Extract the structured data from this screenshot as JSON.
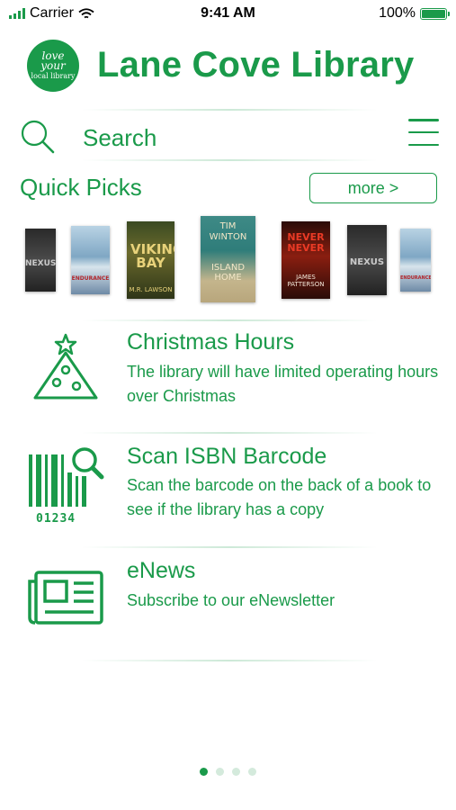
{
  "status_bar": {
    "carrier": "Carrier",
    "time": "9:41 AM",
    "battery": "100%"
  },
  "header": {
    "logo_lines": [
      "love",
      "your",
      "local",
      "library"
    ],
    "title": "Lane Cove Library"
  },
  "search": {
    "placeholder": "Search"
  },
  "quick_picks": {
    "title": "Quick Picks",
    "more_label": "more >",
    "books": [
      {
        "title": "NEXUS",
        "author": ""
      },
      {
        "title": "ENDURANCE",
        "author": ""
      },
      {
        "title": "VIKING BAY",
        "author": "M.R. LAWSON"
      },
      {
        "title": "ISLAND HOME",
        "author": "TIM WINTON"
      },
      {
        "title": "NEVER NEVER",
        "author": "JAMES PATTERSON"
      },
      {
        "title": "NEXUS",
        "author": ""
      },
      {
        "title": "ENDURANCE",
        "author": ""
      }
    ]
  },
  "menu": [
    {
      "title": "Christmas Hours",
      "description": "The library will have limited operating hours over Christmas",
      "icon": "christmas-tree-icon"
    },
    {
      "title": "Scan ISBN Barcode",
      "description": "Scan the barcode on the back of a book to see if the library has a copy",
      "icon": "barcode-scan-icon",
      "barcode_digits": "01234"
    },
    {
      "title": "eNews",
      "description": "Subscribe to our eNewsletter",
      "icon": "newspaper-icon"
    }
  ],
  "pagination": {
    "pages": 4,
    "active": 1
  },
  "colors": {
    "accent": "#1a9a4a"
  }
}
